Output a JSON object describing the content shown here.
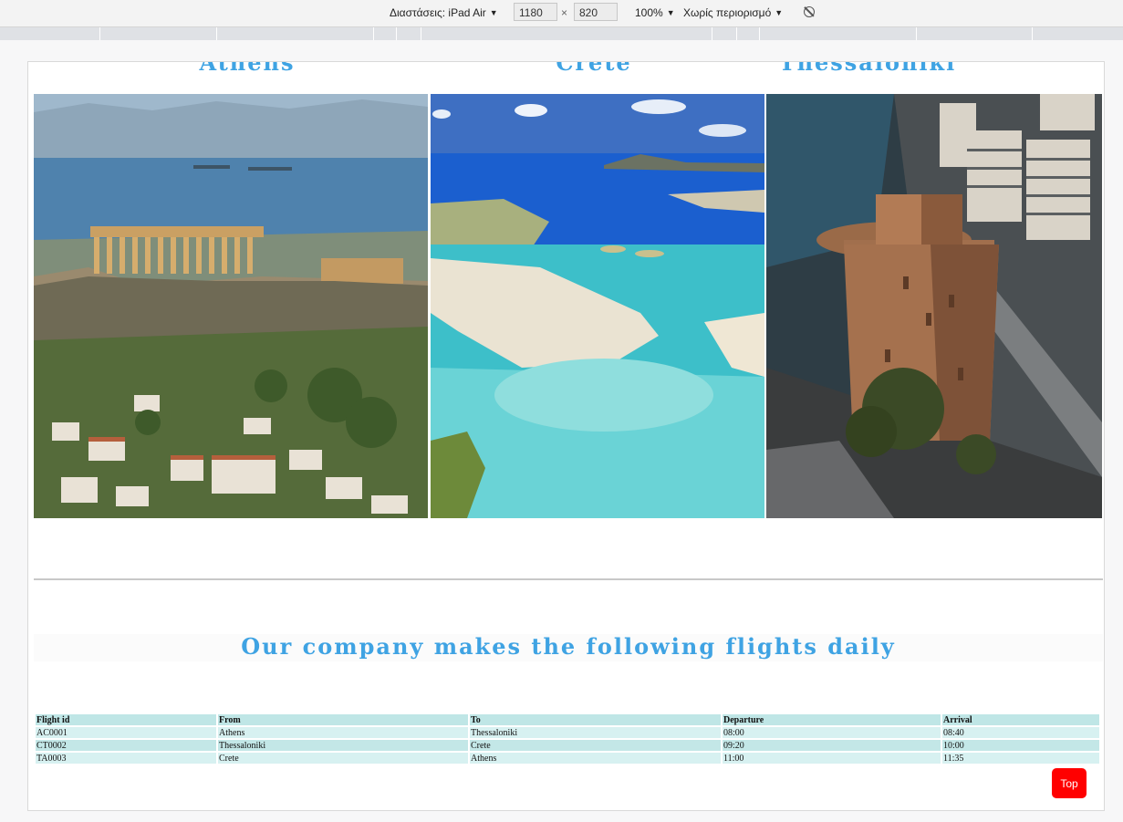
{
  "devtools": {
    "dimensions_label": "Διαστάσεις: iPad Air",
    "width": "1180",
    "times": "×",
    "height": "820",
    "zoom": "100%",
    "throttle": "Χωρίς περιορισμό"
  },
  "destinations": [
    {
      "name": "Athens",
      "photo": "acropolis-parthenon-photo"
    },
    {
      "name": "Crete",
      "photo": "elafonisi-beach-photo"
    },
    {
      "name": "Thessaloniki",
      "photo": "white-tower-photo"
    }
  ],
  "flights_heading": "Our company makes the following flights daily",
  "flights_table": {
    "columns": [
      "Flight id",
      "From",
      "To",
      "Departure",
      "Arrival"
    ],
    "rows": [
      [
        "AC0001",
        "Athens",
        "Thessaloniki",
        "08:00",
        "08:40"
      ],
      [
        "CT0002",
        "Thessaloniki",
        "Crete",
        "09:20",
        "10:00"
      ],
      [
        "TA0003",
        "Crete",
        "Athens",
        "11:00",
        "11:35"
      ]
    ]
  },
  "top_button": "Top",
  "colors": {
    "heading": "#3fa3e3",
    "table_row": "#c9ecec",
    "top_button": "#ff0000"
  }
}
